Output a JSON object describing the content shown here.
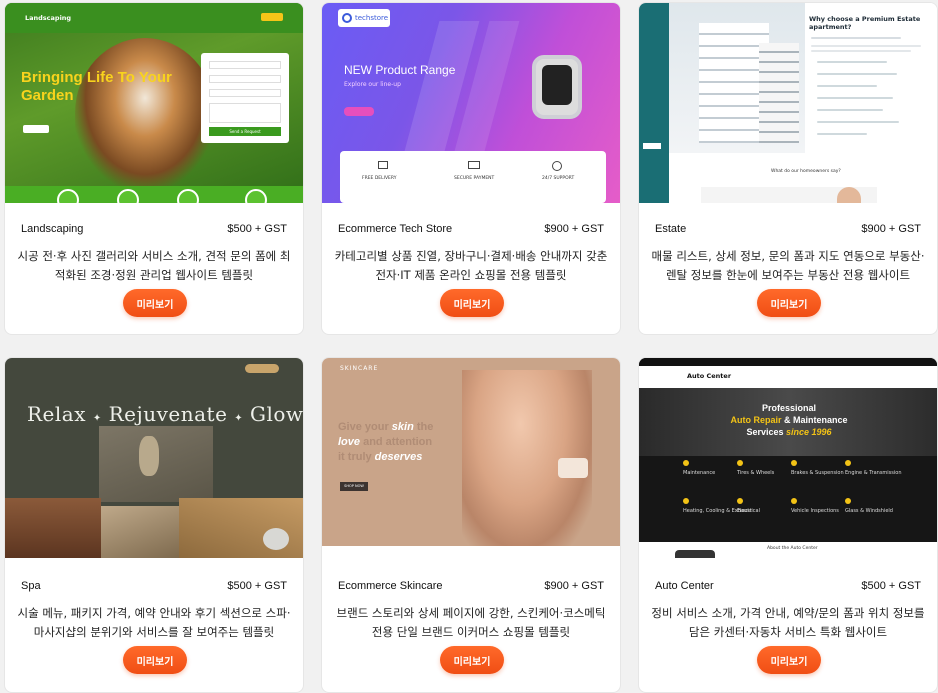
{
  "preview_label": "미리보기",
  "cards": [
    {
      "name": "Landscaping",
      "price": "$500 + GST",
      "desc": "시공 전·후 사진 갤러리와 서비스 소개, 견적 문의 폼에 최적화된 조경·정원 관리업 웹사이트 템플릿",
      "thumb": {
        "brand": "Landscaping",
        "headline1": "Bringing Life To Your",
        "headline2": "Garden",
        "cta": "Send a Request"
      }
    },
    {
      "name": "Ecommerce Tech Store",
      "price": "$900 + GST",
      "desc": "카테고리별 상품 진열, 장바구니·결제·배송 안내까지 갖춘 전자·IT 제품 온라인 쇼핑몰 전용 템플릿",
      "thumb": {
        "brand": "techstore",
        "headline": "NEW Product Range",
        "sub": "Explore our line-up",
        "f1": "FREE DELIVERY",
        "f2": "SECURE PAYMENT",
        "f3": "24/7 SUPPORT"
      }
    },
    {
      "name": "Estate",
      "price": "$900 + GST",
      "desc": "매물 리스트, 상세 정보, 문의 폼과 지도 연동으로 부동산·렌탈 정보를 한눈에 보여주는 부동산 전용 웹사이트",
      "thumb": {
        "headline": "Why choose a Premium Estate apartment?",
        "sub": "What do our homeowners say?"
      }
    },
    {
      "name": "Spa",
      "price": "$500 + GST",
      "desc": "시술 메뉴, 패키지 가격, 예약 안내와 후기 섹션으로 스파·마사지샵의 분위기와 서비스를 잘 보여주는 템플릿",
      "thumb": {
        "w1": "Relax",
        "w2": "Rejuvenate",
        "w3": "Glow"
      }
    },
    {
      "name": "Ecommerce Skincare",
      "price": "$900 + GST",
      "desc": "브랜드 스토리와 상세 페이지에 강한, 스킨케어·코스메틱 전용 단일 브랜드 이커머스 쇼핑몰 템플릿",
      "thumb": {
        "brand": "SKINCARE",
        "l1a": "Give your ",
        "l1b": "skin",
        "l1c": " the",
        "l2a": "love",
        "l2b": " and attention",
        "l3a": "it truly ",
        "l3b": "deserves",
        "cta": "SHOP NOW"
      }
    },
    {
      "name": "Auto Center",
      "price": "$500 + GST",
      "desc": "정비 서비스 소개, 가격 안내, 예약/문의 폼과 위치 정보를 담은 카센터·자동차 서비스 특화 웹사이트",
      "thumb": {
        "brand": "Auto Center",
        "h1": "Professional",
        "h2a": "Auto Repair",
        "h2b": " & Maintenance",
        "h3a": "Services ",
        "h3b": "since 1996",
        "s1": "Maintenance",
        "s2": "Tires & Wheels",
        "s3": "Brakes & Suspension",
        "s4": "Engine & Transmission",
        "s5": "Heating, Cooling & Exhaust",
        "s6": "Electrical",
        "s7": "Vehicle Inspections",
        "s8": "Glass & Windshield",
        "footer": "About the Auto Center"
      }
    }
  ]
}
